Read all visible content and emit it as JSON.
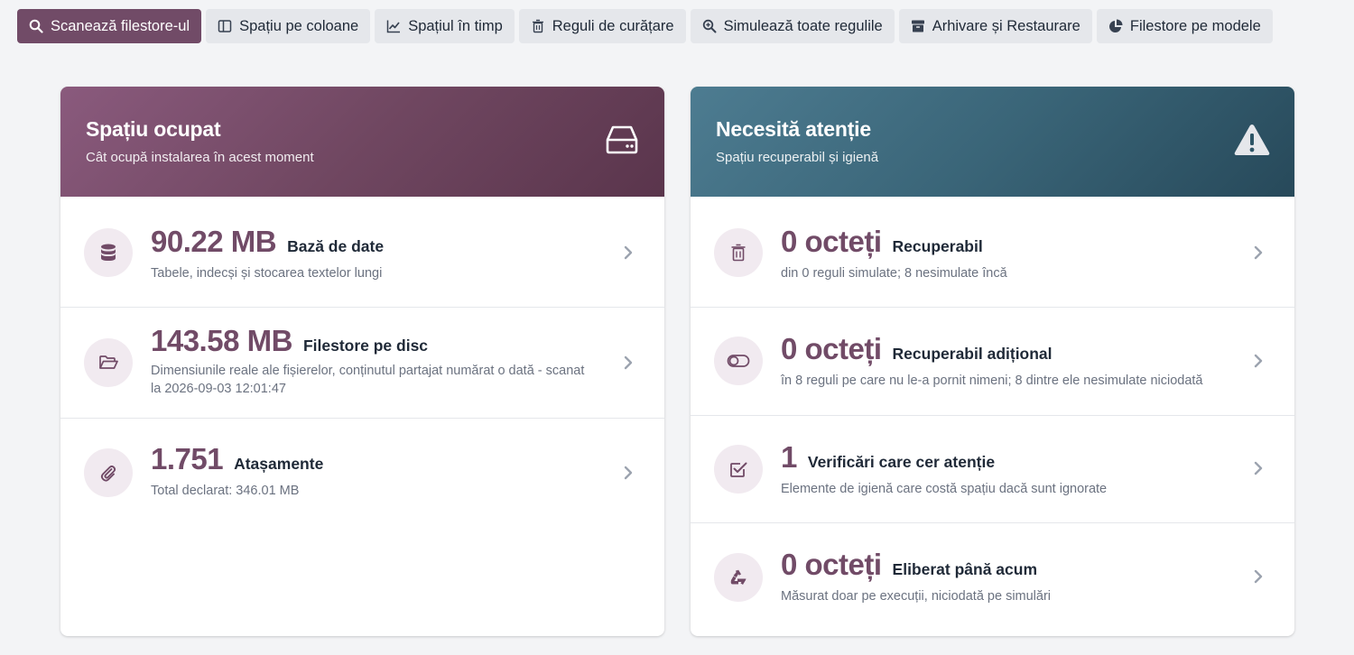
{
  "toolbar": {
    "buttons": [
      {
        "label": "Scanează filestore-ul",
        "icon": "search-icon"
      },
      {
        "label": "Spațiu pe coloane",
        "icon": "columns-icon"
      },
      {
        "label": "Spațiul în timp",
        "icon": "chart-line-icon"
      },
      {
        "label": "Reguli de curățare",
        "icon": "trash-icon"
      },
      {
        "label": "Simulează toate regulile",
        "icon": "search-plus-icon"
      },
      {
        "label": "Arhivare și Restaurare",
        "icon": "archive-icon"
      },
      {
        "label": "Filestore pe modele",
        "icon": "pie-chart-icon"
      }
    ]
  },
  "left_card": {
    "title": "Spațiu ocupat",
    "subtitle": "Cât ocupă instalarea în acest moment",
    "icon": "hard-drive-icon",
    "rows": [
      {
        "value": "90.22 MB",
        "label": "Bază de date",
        "desc": "Tabele, indecși și stocarea textelor lungi",
        "icon": "database-icon"
      },
      {
        "value": "143.58 MB",
        "label": "Filestore pe disc",
        "desc": "Dimensiunile reale ale fișierelor, conținutul partajat numărat o dată - scanat la 2026-09-03 12:01:47",
        "icon": "folder-open-icon"
      },
      {
        "value": "1.751",
        "label": "Atașamente",
        "desc": "Total declarat: 346.01 MB",
        "icon": "paperclip-icon"
      }
    ]
  },
  "right_card": {
    "title": "Necesită atenție",
    "subtitle": "Spațiu recuperabil și igienă",
    "icon": "warning-icon",
    "rows": [
      {
        "value": "0 octeți",
        "label": "Recuperabil",
        "desc": "din 0 reguli simulate; 8 nesimulate încă",
        "icon": "trash-icon"
      },
      {
        "value": "0 octeți",
        "label": "Recuperabil adițional",
        "desc": "în 8 reguli pe care nu le-a pornit nimeni; 8 dintre ele nesimulate niciodată",
        "icon": "toggle-off-icon"
      },
      {
        "value": "1",
        "label": "Verificări care cer atenție",
        "desc": "Elemente de igienă care costă spațiu dacă sunt ignorate",
        "icon": "check-square-icon"
      },
      {
        "value": "0 octeți",
        "label": "Eliberat până acum",
        "desc": "Măsurat doar pe execuții, niciodată pe simulări",
        "icon": "recycle-icon"
      }
    ]
  },
  "colors": {
    "primary": "#714b67",
    "left_header": "#6b4560",
    "right_header": "#3a6578",
    "icon_bg": "#f1eaf0"
  }
}
